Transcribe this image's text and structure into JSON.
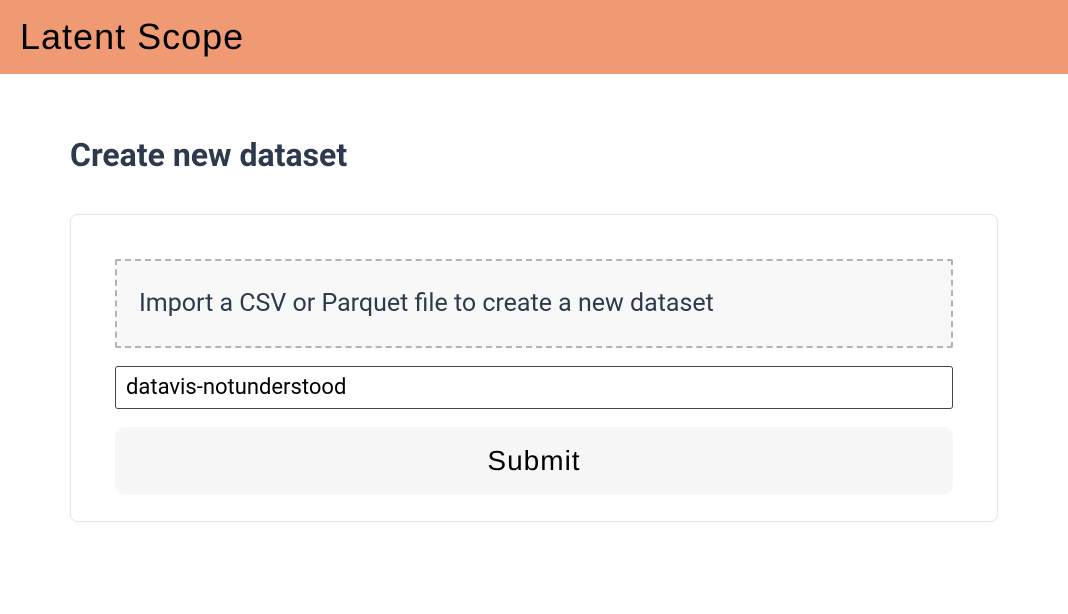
{
  "header": {
    "logo_text": "Latent Scope"
  },
  "page": {
    "title": "Create new dataset"
  },
  "form": {
    "dropzone_text": "Import a CSV or Parquet file to create a new dataset",
    "name_input_value": "datavis-notunderstood",
    "submit_label": "Submit"
  }
}
